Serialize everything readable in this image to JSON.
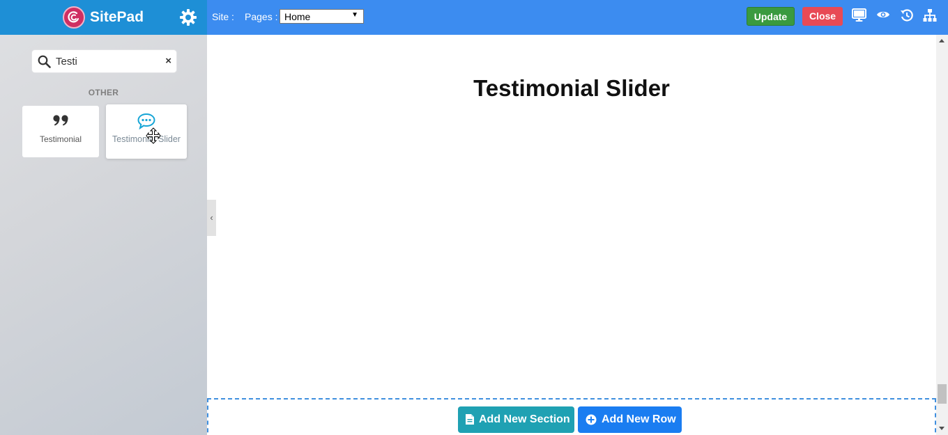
{
  "brand": {
    "name": "SitePad"
  },
  "sidebar": {
    "search": {
      "value": "Testi",
      "clear_symbol": "×"
    },
    "category": "OTHER",
    "widgets": [
      {
        "label": "Testimonial",
        "icon": "quote-icon"
      },
      {
        "label": "Testimonial Slider",
        "icon": "chat-bubble-icon"
      }
    ],
    "collapse_symbol": "‹"
  },
  "topbar": {
    "site_label": "Site :",
    "pages_label": "Pages :",
    "pages_selected": "Home",
    "update_label": "Update",
    "close_label": "Close",
    "icons": [
      "desktop-icon",
      "eye-icon",
      "history-icon",
      "sitemap-icon"
    ]
  },
  "canvas": {
    "heading": "Testimonial Slider",
    "add_section_label": "Add New Section",
    "add_row_label": "Add New Row"
  },
  "colors": {
    "brand_bar": "#1e8fd6",
    "topbar": "#3c8cf0",
    "update": "#3a9a3f",
    "close": "#e84a55",
    "add_section": "#1fa1b3",
    "add_row": "#1a7df1",
    "drop_zone_border": "#3f8fdf"
  }
}
